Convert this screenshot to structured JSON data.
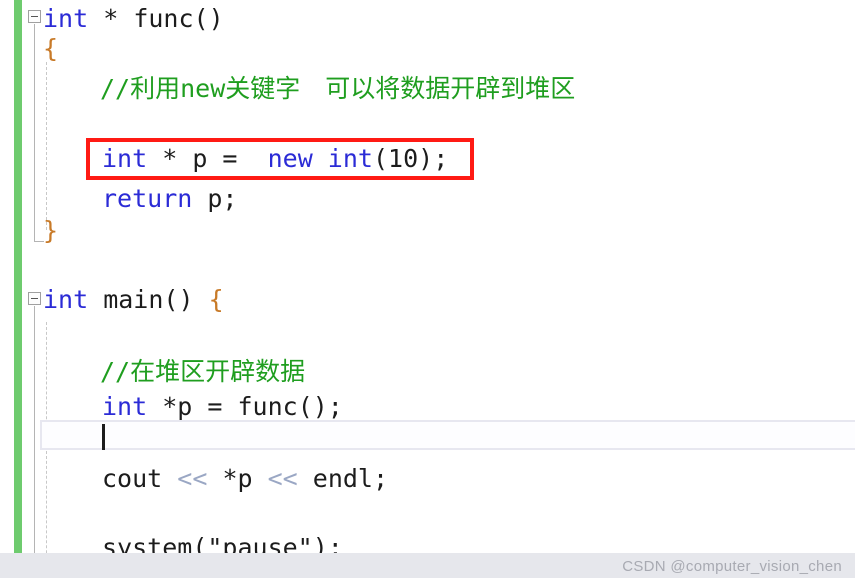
{
  "editor": {
    "app": "visual-studio-code-editor",
    "language": "cpp",
    "background_color": "#ffffff",
    "change_bar_color": "#6ecb6e",
    "keyword_color": "#2b2bd6",
    "comment_color": "#1f9e1f",
    "annotation_color": "#ff1a14",
    "current_line_border_color": "#e7e7f0"
  },
  "code": {
    "line1": {
      "kw_int": "int",
      "star": " * ",
      "name": "func",
      "parens": "()"
    },
    "line2": {
      "brace": "{"
    },
    "line3": {
      "comment": "//利用new关键字　可以将数据开辟到堆区"
    },
    "line4": {
      "kw_int": "int",
      "star": " * ",
      "var": "p",
      "assign": " =  ",
      "kw_new": "new",
      "kw_int2": " int",
      "open": "(",
      "number": "10",
      "close": ");"
    },
    "line5": {
      "kw_return": "return",
      "var": " p;"
    },
    "line6": {
      "brace": "}"
    },
    "line7": {
      "kw_int": "int",
      "name": " main",
      "parens": "() ",
      "brace": "{"
    },
    "line8": {
      "comment": "//在堆区开辟数据"
    },
    "line9": {
      "kw_int": "int",
      "var": " *p = ",
      "call": "func",
      "parens": "();"
    },
    "line10": {
      "text": ""
    },
    "line11": {
      "stream": "cout",
      "op1": " << ",
      "deref": "*p",
      "op2": " << ",
      "endl": "endl;"
    },
    "line12": {
      "call": "system",
      "open": "(",
      "string": "\"pause\"",
      "close": ");"
    }
  },
  "watermark": {
    "text": "CSDN @computer_vision_chen"
  }
}
